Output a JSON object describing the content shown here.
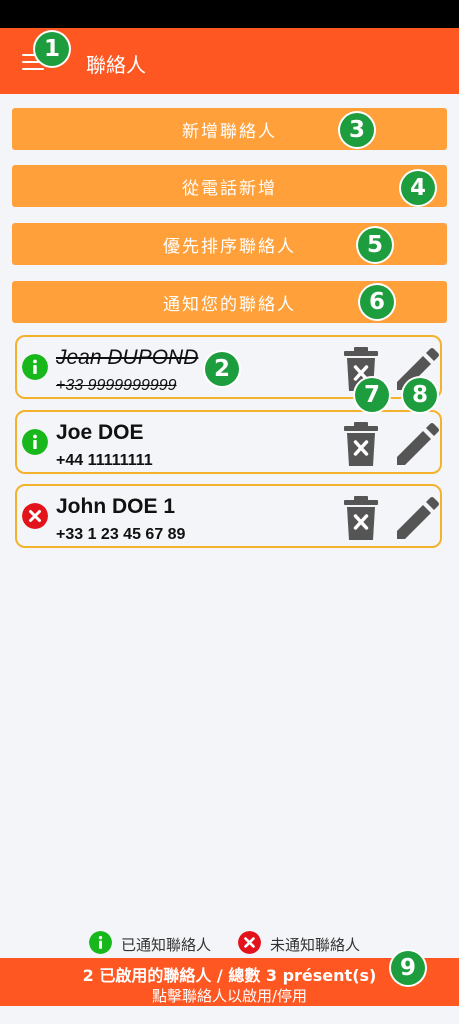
{
  "app_bar": {
    "title": "聯絡人"
  },
  "actions": {
    "add_contact": "新增聯絡人",
    "add_from_phone": "從電話新增",
    "prioritize": "優先排序聯絡人",
    "notify": "通知您的聯絡人"
  },
  "contacts": [
    {
      "name": "Jean DUPOND",
      "phone": "+33 9999999999",
      "notified": true,
      "enabled": false
    },
    {
      "name": "Joe DOE",
      "phone": "+44 11111111",
      "notified": true,
      "enabled": true
    },
    {
      "name": "John DOE 1",
      "phone": "+33 1 23 45 67 89",
      "notified": false,
      "enabled": true
    }
  ],
  "legend": {
    "notified": "已通知聯絡人",
    "not_notified": "未通知聯絡人"
  },
  "footer": {
    "summary": "2 已啟用的聯絡人 / 總數 3 présent(s)",
    "hint": "點擊聯絡人以啟用/停用"
  },
  "badges": [
    "1",
    "2",
    "3",
    "4",
    "5",
    "6",
    "7",
    "8",
    "9"
  ],
  "colors": {
    "primary": "#ff5722",
    "button": "#ffa03a",
    "card_border": "#f4b22c",
    "notified": "#18b81c",
    "not_notified": "#e3131b",
    "badge": "#1e9d3e"
  },
  "icons": {
    "menu": "menu-icon",
    "info": "info-icon",
    "error": "close-icon",
    "trash": "trash-icon",
    "edit": "pencil-icon"
  }
}
